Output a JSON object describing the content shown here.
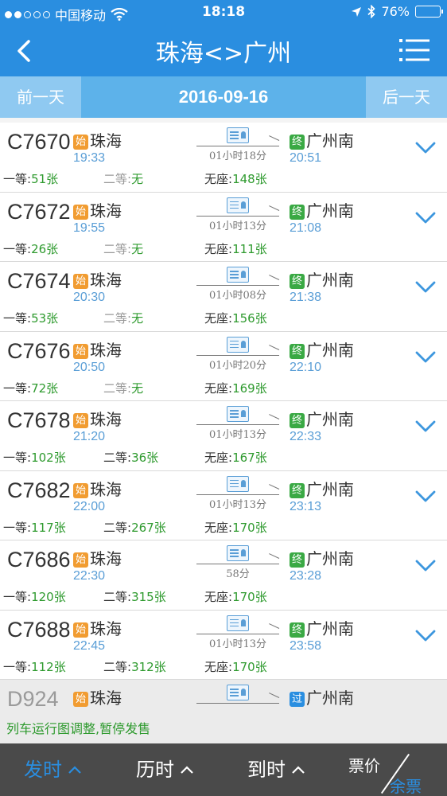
{
  "status_bar": {
    "carrier": "中国移动",
    "time": "18:18",
    "battery": "76%",
    "battery_level": 0.76
  },
  "nav": {
    "title": "珠海<>广州"
  },
  "date_bar": {
    "prev_label": "前一天",
    "date": "2016-09-16",
    "next_label": "后一天"
  },
  "trains": [
    {
      "number": "C7670",
      "from_badge": "始",
      "from": "珠海",
      "depart": "19:33",
      "duration": "01小时18分",
      "to_badge": "终",
      "to": "广州南",
      "arrive": "20:51",
      "seat1_label": "一等:",
      "seat1": "51张",
      "seat2_label": "二等:",
      "seat2": "无",
      "seat3_label": "无座:",
      "seat3": "148张"
    },
    {
      "number": "C7672",
      "from_badge": "始",
      "from": "珠海",
      "depart": "19:55",
      "duration": "01小时13分",
      "to_badge": "终",
      "to": "广州南",
      "arrive": "21:08",
      "seat1_label": "一等:",
      "seat1": "26张",
      "seat2_label": "二等:",
      "seat2": "无",
      "seat3_label": "无座:",
      "seat3": "111张"
    },
    {
      "number": "C7674",
      "from_badge": "始",
      "from": "珠海",
      "depart": "20:30",
      "duration": "01小时08分",
      "to_badge": "终",
      "to": "广州南",
      "arrive": "21:38",
      "seat1_label": "一等:",
      "seat1": "53张",
      "seat2_label": "二等:",
      "seat2": "无",
      "seat3_label": "无座:",
      "seat3": "156张"
    },
    {
      "number": "C7676",
      "from_badge": "始",
      "from": "珠海",
      "depart": "20:50",
      "duration": "01小时20分",
      "to_badge": "终",
      "to": "广州南",
      "arrive": "22:10",
      "seat1_label": "一等:",
      "seat1": "72张",
      "seat2_label": "二等:",
      "seat2": "无",
      "seat3_label": "无座:",
      "seat3": "169张"
    },
    {
      "number": "C7678",
      "from_badge": "始",
      "from": "珠海",
      "depart": "21:20",
      "duration": "01小时13分",
      "to_badge": "终",
      "to": "广州南",
      "arrive": "22:33",
      "seat1_label": "一等:",
      "seat1": "102张",
      "seat2_label": "二等:",
      "seat2": "36张",
      "seat3_label": "无座:",
      "seat3": "167张"
    },
    {
      "number": "C7682",
      "from_badge": "始",
      "from": "珠海",
      "depart": "22:00",
      "duration": "01小时13分",
      "to_badge": "终",
      "to": "广州南",
      "arrive": "23:13",
      "seat1_label": "一等:",
      "seat1": "117张",
      "seat2_label": "二等:",
      "seat2": "267张",
      "seat3_label": "无座:",
      "seat3": "170张"
    },
    {
      "number": "C7686",
      "from_badge": "始",
      "from": "珠海",
      "depart": "22:30",
      "duration": "58分",
      "to_badge": "终",
      "to": "广州南",
      "arrive": "23:28",
      "seat1_label": "一等:",
      "seat1": "120张",
      "seat2_label": "二等:",
      "seat2": "315张",
      "seat3_label": "无座:",
      "seat3": "170张"
    },
    {
      "number": "C7688",
      "from_badge": "始",
      "from": "珠海",
      "depart": "22:45",
      "duration": "01小时13分",
      "to_badge": "终",
      "to": "广州南",
      "arrive": "23:58",
      "seat1_label": "一等:",
      "seat1": "112张",
      "seat2_label": "二等:",
      "seat2": "312张",
      "seat3_label": "无座:",
      "seat3": "170张"
    }
  ],
  "suspended_train": {
    "number": "D924",
    "from_badge": "始",
    "from": "珠海",
    "to_badge": "过",
    "to": "广州南",
    "notice": "列车运行图调整,暂停发售"
  },
  "bottom_bar": {
    "sort_depart": "发时",
    "sort_duration": "历时",
    "sort_arrive": "到时",
    "price_label": "票价",
    "stock_label": "余票"
  },
  "colors": {
    "primary": "#2a8ee0",
    "start_badge": "#f19c31",
    "end_badge": "#3aa944",
    "seat_count": "#2e9a2e"
  }
}
